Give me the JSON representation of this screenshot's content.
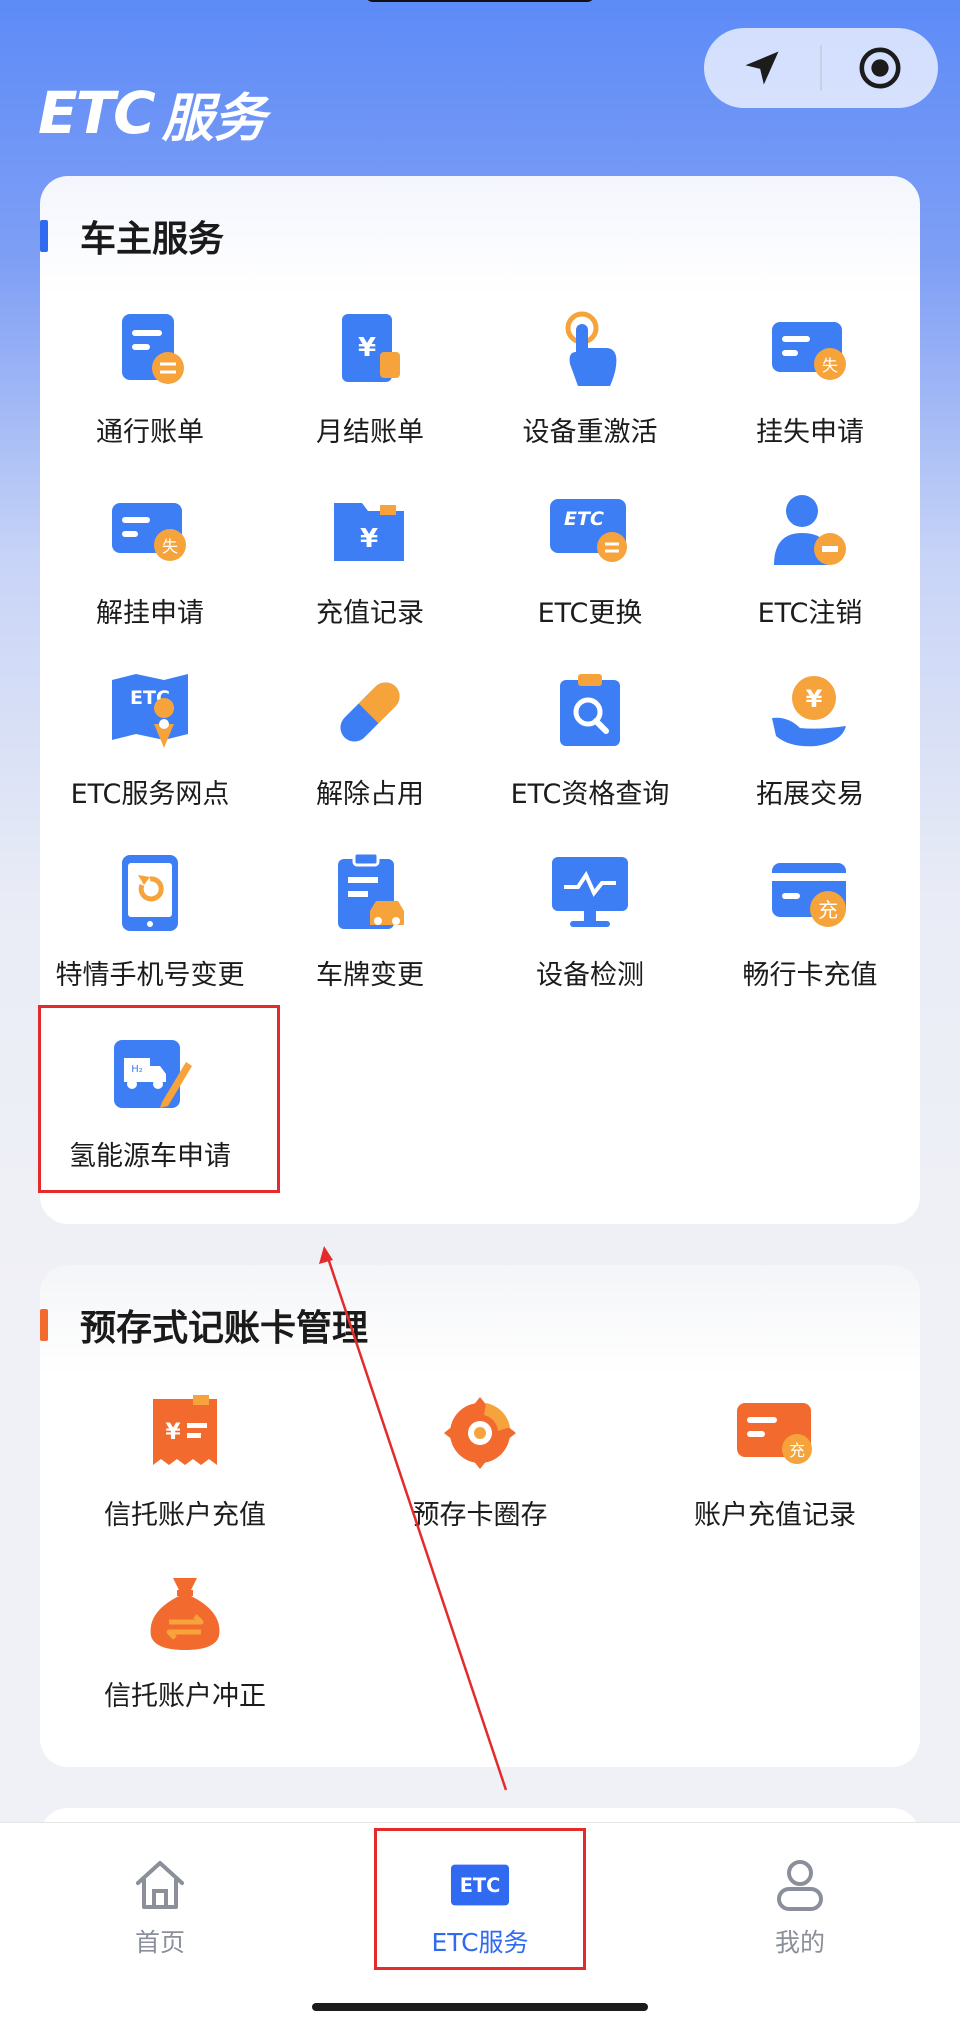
{
  "header": {
    "brand_latin": "ETC",
    "brand_cn": "服务"
  },
  "owner_services": {
    "title": "车主服务",
    "accent_color": "#2f6af0",
    "items": [
      {
        "label": "通行账单",
        "icon": "bill-icon"
      },
      {
        "label": "月结账单",
        "icon": "monthly-bill-icon"
      },
      {
        "label": "设备重激活",
        "icon": "tap-finger-icon"
      },
      {
        "label": "挂失申请",
        "icon": "card-loss-icon"
      },
      {
        "label": "解挂申请",
        "icon": "card-unloss-icon"
      },
      {
        "label": "充值记录",
        "icon": "recharge-folder-icon"
      },
      {
        "label": "ETC更换",
        "icon": "etc-card-swap-icon"
      },
      {
        "label": "ETC注销",
        "icon": "user-remove-icon"
      },
      {
        "label": "ETC服务网点",
        "icon": "map-pin-icon"
      },
      {
        "label": "解除占用",
        "icon": "bandage-icon"
      },
      {
        "label": "ETC资格查询",
        "icon": "search-clipboard-icon"
      },
      {
        "label": "拓展交易",
        "icon": "hand-coin-icon"
      },
      {
        "label": "特情手机号变更",
        "icon": "phone-refresh-icon"
      },
      {
        "label": "车牌变更",
        "icon": "car-plate-doc-icon"
      },
      {
        "label": "设备检测",
        "icon": "monitor-pulse-icon"
      },
      {
        "label": "畅行卡充值",
        "icon": "card-charge-icon"
      },
      {
        "label": "氢能源车申请",
        "icon": "hydrogen-truck-icon"
      }
    ]
  },
  "prepaid": {
    "title": "预存式记账卡管理",
    "accent_color": "#f26a2e",
    "items": [
      {
        "label": "信托账户充值",
        "icon": "receipt-yen-icon"
      },
      {
        "label": "预存卡圈存",
        "icon": "gear-circle-icon"
      },
      {
        "label": "账户充值记录",
        "icon": "card-record-icon"
      },
      {
        "label": "信托账户冲正",
        "icon": "money-bag-icon"
      }
    ]
  },
  "tabbar": {
    "tabs": [
      {
        "label": "首页",
        "icon": "home-icon"
      },
      {
        "label": "ETC服务",
        "icon": "etc-badge-icon",
        "badge": "ETC"
      },
      {
        "label": "我的",
        "icon": "user-icon"
      }
    ],
    "active_color": "#2f6af0"
  }
}
